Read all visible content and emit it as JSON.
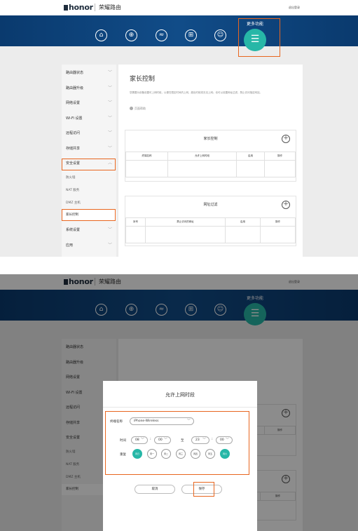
{
  "header": {
    "logo": "honor",
    "brand": "荣耀路由",
    "logout": "退出登录"
  },
  "nav": {
    "icons": [
      "home-icon",
      "globe-icon",
      "wifi-icon",
      "network-icon",
      "user-icon"
    ],
    "more_label": "更多功能",
    "menu_glyph": "☰"
  },
  "sidebar": {
    "items": [
      {
        "label": "路由器状态"
      },
      {
        "label": "路由器升级"
      },
      {
        "label": "网络设置"
      },
      {
        "label": "Wi-Fi 设置"
      },
      {
        "label": "远程访问"
      },
      {
        "label": "存储共享"
      },
      {
        "label": "安全设置"
      }
    ],
    "sub_items": [
      {
        "label": "防火墙"
      },
      {
        "label": "NAT 服务"
      },
      {
        "label": "DMZ 主机"
      },
      {
        "label": "家长控制"
      }
    ],
    "after_items": [
      {
        "label": "系统设置"
      },
      {
        "label": "应用"
      }
    ]
  },
  "content": {
    "title": "家长控制",
    "description": "您需要为设备设置可上网时段，以便在限定时间内上网，超出时段将无法上网；也可以设置网址过滤，禁止访问指定网站。",
    "help": "页面帮助",
    "parental": {
      "title": "家长控制",
      "columns": [
        "终端名称",
        "允许上网时段",
        "启用",
        "操作"
      ]
    },
    "url_filter": {
      "title": "网址过滤",
      "columns": [
        "序号",
        "禁止访问的网址",
        "启用",
        "操作"
      ]
    }
  },
  "dialog": {
    "title": "允许上网时段",
    "device_label": "终端名称",
    "device_value": "iPhone-Wireless",
    "time_label": "时间",
    "time_start_hour": "08",
    "time_start_min": "00",
    "to_label": "至",
    "time_end_hour": "23",
    "time_end_min": "00",
    "colon": ":",
    "repeat_label": "重复",
    "days": [
      {
        "label": "周日",
        "on": true
      },
      {
        "label": "周一",
        "on": false
      },
      {
        "label": "周二",
        "on": false
      },
      {
        "label": "周三",
        "on": false
      },
      {
        "label": "周四",
        "on": false
      },
      {
        "label": "周五",
        "on": false
      },
      {
        "label": "周六",
        "on": true
      }
    ],
    "cancel": "取消",
    "save": "保存"
  },
  "colors": {
    "accent": "#27b7a7",
    "highlight": "#e8661f",
    "nav": "#0e4580"
  }
}
